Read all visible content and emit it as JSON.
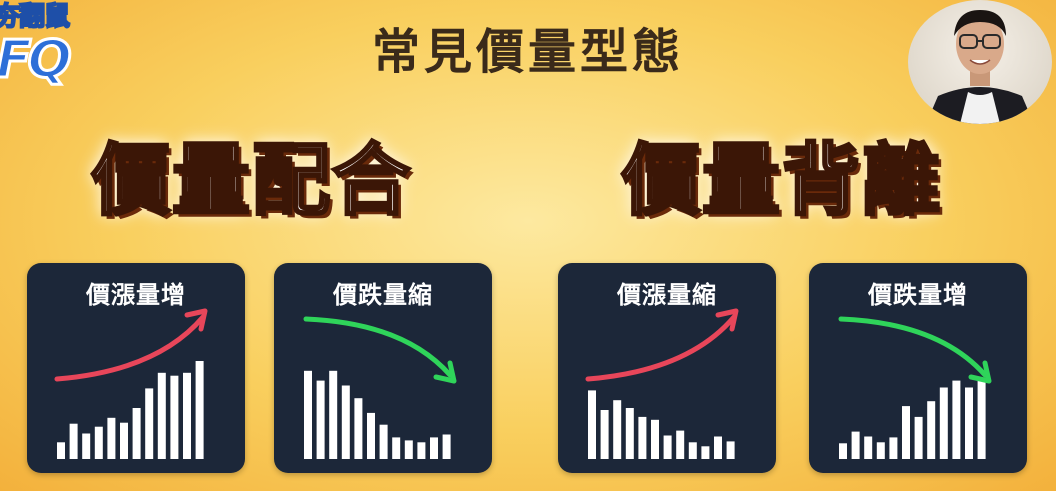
{
  "logo": {
    "line1": "夯翻鼠",
    "line2": "FQ"
  },
  "title": "常見價量型態",
  "sections": [
    {
      "title": "價量配合"
    },
    {
      "title": "價量背離"
    }
  ],
  "colors": {
    "up_arrow": "#e8465a",
    "down_arrow": "#2fd45a",
    "bar": "#ffffff",
    "panel": "#1c2739"
  },
  "panels": [
    {
      "label": "價漲量增",
      "trend": "up",
      "bars": [
        0.17,
        0.36,
        0.26,
        0.33,
        0.42,
        0.37,
        0.52,
        0.72,
        0.88,
        0.85,
        0.88,
        1.0
      ]
    },
    {
      "label": "價跌量縮",
      "trend": "down",
      "bars": [
        0.9,
        0.8,
        0.9,
        0.75,
        0.62,
        0.47,
        0.35,
        0.22,
        0.19,
        0.17,
        0.22,
        0.25
      ]
    },
    {
      "label": "價漲量縮",
      "trend": "up",
      "bars": [
        0.7,
        0.5,
        0.6,
        0.52,
        0.43,
        0.4,
        0.24,
        0.29,
        0.17,
        0.13,
        0.23,
        0.18
      ]
    },
    {
      "label": "價跌量增",
      "trend": "down",
      "bars": [
        0.16,
        0.28,
        0.23,
        0.17,
        0.22,
        0.54,
        0.43,
        0.59,
        0.73,
        0.8,
        0.73,
        0.82
      ]
    }
  ]
}
